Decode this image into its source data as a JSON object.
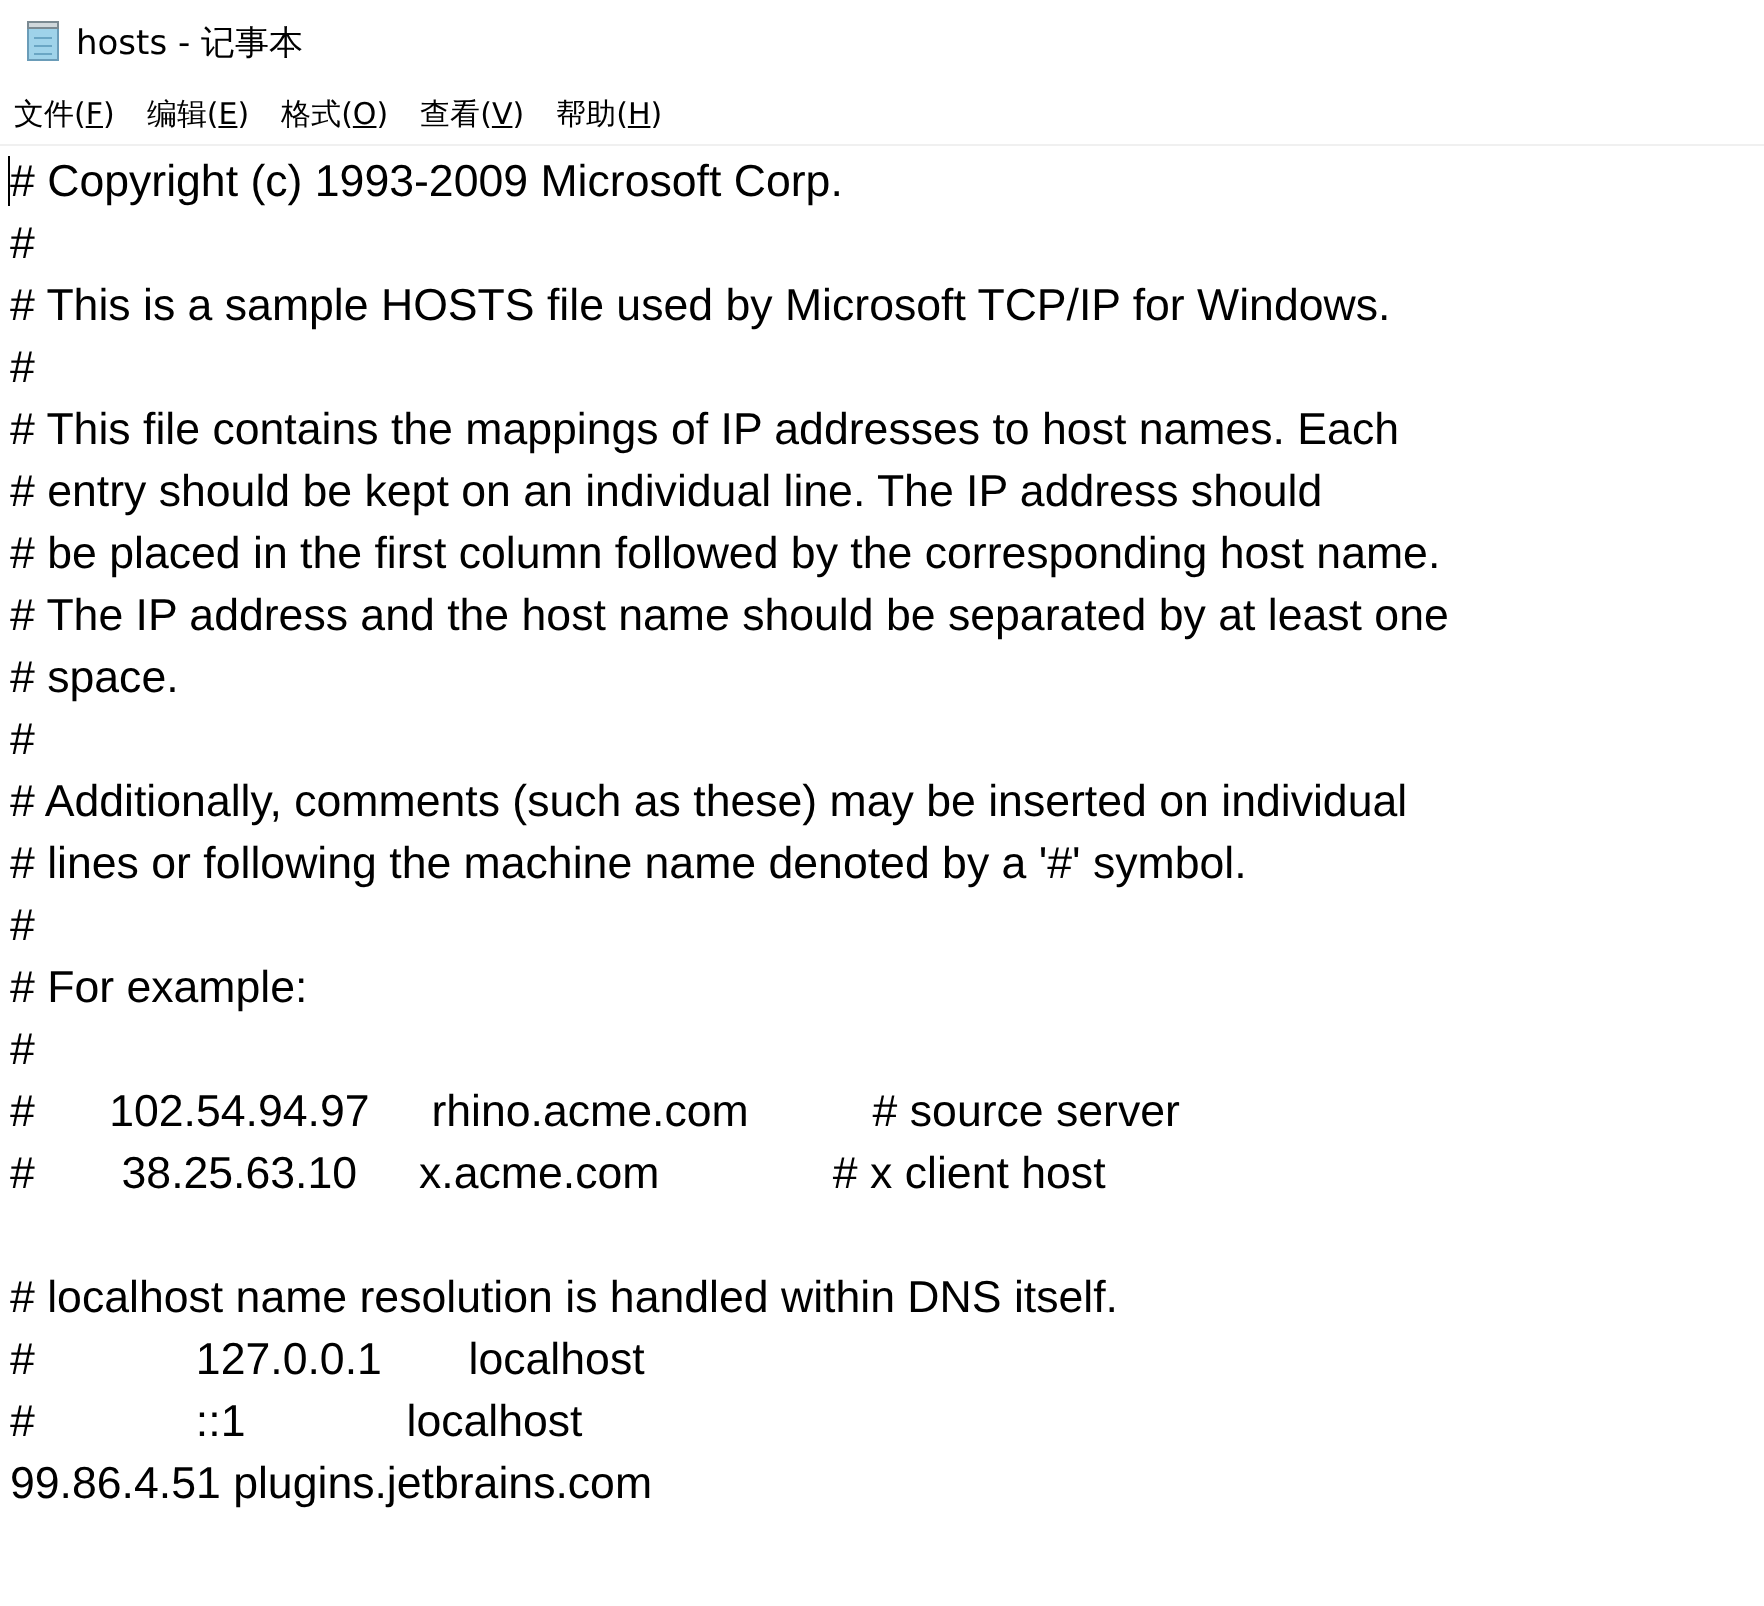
{
  "window": {
    "title": "hosts - 记事本"
  },
  "menu": [
    {
      "label": "文件(F)"
    },
    {
      "label": "编辑(E)"
    },
    {
      "label": "格式(O)"
    },
    {
      "label": "查看(V)"
    },
    {
      "label": "帮助(H)"
    }
  ],
  "editor": {
    "lines": [
      {
        "kind": "text",
        "text": "# Copyright (c) 1993-2009 Microsoft Corp."
      },
      {
        "kind": "text",
        "text": "#"
      },
      {
        "kind": "text",
        "text": "# This is a sample HOSTS file used by Microsoft TCP/IP for Windows."
      },
      {
        "kind": "text",
        "text": "#"
      },
      {
        "kind": "text",
        "text": "# This file contains the mappings of IP addresses to host names. Each"
      },
      {
        "kind": "text",
        "text": "# entry should be kept on an individual line. The IP address should"
      },
      {
        "kind": "text",
        "text": "# be placed in the first column followed by the corresponding host name."
      },
      {
        "kind": "text",
        "text": "# The IP address and the host name should be separated by at least one"
      },
      {
        "kind": "text",
        "text": "# space."
      },
      {
        "kind": "text",
        "text": "#"
      },
      {
        "kind": "text",
        "text": "# Additionally, comments (such as these) may be inserted on individual"
      },
      {
        "kind": "text",
        "text": "# lines or following the machine name denoted by a '#' symbol."
      },
      {
        "kind": "text",
        "text": "#"
      },
      {
        "kind": "text",
        "text": "# For example:"
      },
      {
        "kind": "text",
        "text": "#"
      },
      {
        "kind": "text",
        "text": "#      102.54.94.97     rhino.acme.com          # source server"
      },
      {
        "kind": "text",
        "text": "#       38.25.63.10     x.acme.com              # x client host"
      },
      {
        "kind": "blank"
      },
      {
        "kind": "text",
        "text": "# localhost name resolution is handled within DNS itself."
      },
      {
        "kind": "text",
        "text": "#             127.0.0.1       localhost"
      },
      {
        "kind": "text",
        "text": "#             ::1             localhost"
      },
      {
        "kind": "text",
        "text": "99.86.4.51 plugins.jetbrains.com"
      }
    ]
  }
}
